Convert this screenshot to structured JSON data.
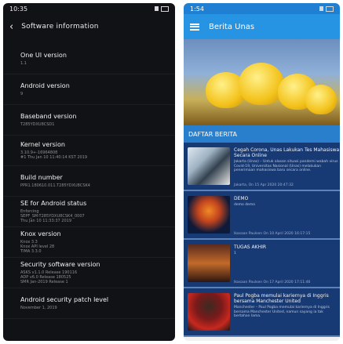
{
  "left": {
    "status": {
      "time": "10:35"
    },
    "title": "Software information",
    "items": [
      {
        "title": "One UI version",
        "value": "1.1"
      },
      {
        "title": "Android version",
        "value": "9"
      },
      {
        "title": "Baseband version",
        "value": "T285YDXU8CSD1"
      },
      {
        "title": "Kernel version",
        "value": "3.10.9+-16964808\n#1 Thu Jan 10 11:40:14 KST 2019"
      },
      {
        "title": "Build number",
        "value": "PPR1.180610.011.T285YDXU8CSK4"
      },
      {
        "title": "SE for Android status",
        "value": "Enforcing\nSEPF_SM-T285YDXU8CSK4_0007\nThu Jan 10 11:33:37 2019"
      },
      {
        "title": "Knox version",
        "value": "Knox 3.3\nKnox API level 28\nTIMA 3.3.0"
      },
      {
        "title": "Security software version",
        "value": "ASKS v1.1.0 Release 190116\nADP v6.0 Release 180525\nSMR Jan-2019 Release 1"
      },
      {
        "title": "Android security patch level",
        "value": "November 1, 2019"
      }
    ]
  },
  "right": {
    "status": {
      "time": "1:54"
    },
    "title": "Berita Unas",
    "section": "DAFTAR BERITA",
    "news": [
      {
        "title": "Cegah Corona, Unas Lakukan Tes Mahasiswa Secara Online",
        "snippet": "Jakarta (Unas) – Untuk alasan situasi pandemi wabah virus Covid-19, Universitas Nasional (Unas) melakukan penerimaan mahasiswa baru secara online.",
        "date": "Jakarta, On 15 Apr 2020 20:47:32"
      },
      {
        "title": "DEMO",
        "snippet": "demo demo",
        "date": "Ikasaan Paulsen On 10 April 2020 16:17:15"
      },
      {
        "title": "TUGAS AKHIR",
        "snippet": "1",
        "date": "Ikasaan Paulsen On 17 April 2020 17:11:46"
      },
      {
        "title": "Paul Pogba memulai kariernya di Inggris bersama Manchester United",
        "snippet": "Manchester – Paul Pogba memulai kariernya di Inggris bersama Manchester United, namun sayang ia tak bertahan lama.",
        "date": ""
      }
    ]
  },
  "colors": {
    "dark_bg": "#101215",
    "accent_blue": "#2693e3",
    "card_blue": "#183a74"
  }
}
